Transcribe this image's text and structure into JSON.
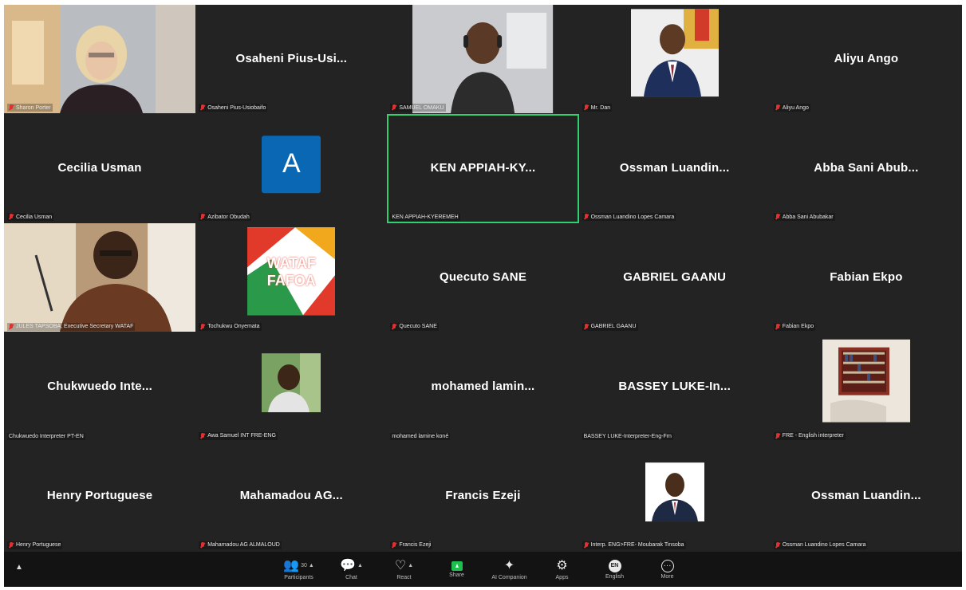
{
  "tiles": [
    {
      "center": "",
      "label": "Sharon Porter",
      "type": "video1"
    },
    {
      "center": "Osaheni Pius-Usi...",
      "label": "Osaheni Pius-Usiobaifo",
      "type": "name"
    },
    {
      "center": "",
      "label": "SAMUEL OMAKU",
      "type": "video2"
    },
    {
      "center": "",
      "label": "Mr. Dan",
      "type": "photo1"
    },
    {
      "center": "Aliyu Ango",
      "label": "Aliyu Ango",
      "type": "name"
    },
    {
      "center": "Cecilia Usman",
      "label": "Cecilia Usman",
      "type": "name"
    },
    {
      "center": "A",
      "label": "Azibator Obudah",
      "type": "letter"
    },
    {
      "center": "KEN APPIAH-KY...",
      "label": "KEN APPIAH-KYEREMEH",
      "type": "name-active"
    },
    {
      "center": "Ossman Luandin...",
      "label": "Ossman Luandino Lopes Camara",
      "type": "name"
    },
    {
      "center": "Abba Sani Abub...",
      "label": "Abba Sani Abubakar",
      "type": "name"
    },
    {
      "center": "",
      "label": "JULES TAPSOBA, Executive Secretary WATAF",
      "type": "video3"
    },
    {
      "center": "WATAF FAFOA",
      "label": "Tochukwu Onyemata",
      "type": "logo"
    },
    {
      "center": "Quecuto SANE",
      "label": "Quecuto SANE",
      "type": "name"
    },
    {
      "center": "GABRIEL GAANU",
      "label": "GABRIEL GAANU",
      "type": "name"
    },
    {
      "center": "Fabian Ekpo",
      "label": "Fabian Ekpo",
      "type": "name"
    },
    {
      "center": "Chukwuedo Inte...",
      "label": "Chukwuedo Interpreter PT-EN",
      "type": "name-nomic"
    },
    {
      "center": "",
      "label": "Awa Samuel INT FRE-ENG",
      "type": "photo2"
    },
    {
      "center": "mohamed lamin...",
      "label": "mohamed lamine koné",
      "type": "name-nomic"
    },
    {
      "center": "BASSEY LUKE-In...",
      "label": "BASSEY LUKE-Interpreter-Eng-Frn",
      "type": "name-nomic"
    },
    {
      "center": "",
      "label": "FRE - English interpreter",
      "type": "photo3"
    },
    {
      "center": "Henry Portuguese",
      "label": "Henry Portuguese",
      "type": "name"
    },
    {
      "center": "Mahamadou AG...",
      "label": "Mahamadou AG ALMALOUD",
      "type": "name"
    },
    {
      "center": "Francis Ezeji",
      "label": "Francis Ezeji",
      "type": "name"
    },
    {
      "center": "",
      "label": "Interp. ENG>FRE- Moubarak Tinsoba",
      "type": "photo4"
    },
    {
      "center": "Ossman Luandin...",
      "label": "Ossman Luandino Lopes Camara",
      "type": "name"
    }
  ],
  "toolbar": {
    "participants_count": "30",
    "participants_label": "Participants",
    "chat_label": "Chat",
    "react_label": "React",
    "share_label": "Share",
    "ai_label": "AI Companion",
    "apps_label": "Apps",
    "english_badge": "EN",
    "english_label": "English",
    "more_label": "More"
  }
}
